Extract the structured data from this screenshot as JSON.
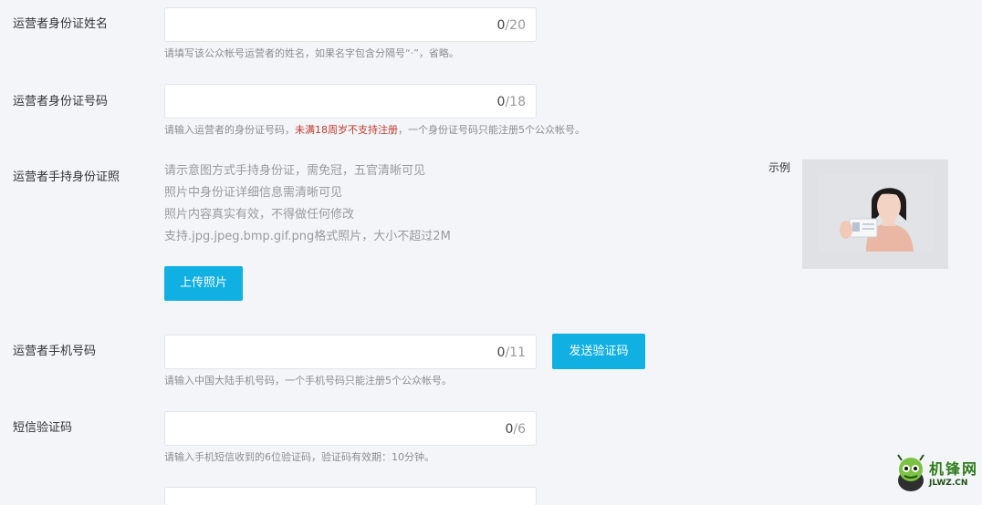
{
  "fields": {
    "name": {
      "label": "运营者身份证姓名",
      "count": "0",
      "max": "/20",
      "hint": "请填写该公众帐号运营者的姓名，如果名字包含分隔号“·”，省略。"
    },
    "id_number": {
      "label": "运营者身份证号码",
      "count": "0",
      "max": "/18",
      "hint_before": "请输入运营者的身份证号码，",
      "hint_warning": "未满18周岁不支持注册",
      "hint_after": "，一个身份证号码只能注册5个公众帐号。"
    },
    "photo": {
      "label": "运营者手持身份证照",
      "desc": [
        "请示意图方式手持身份证，需免冠，五官清晰可见",
        "照片中身份证详细信息需清晰可见",
        "照片内容真实有效，不得做任何修改",
        "支持.jpg.jpeg.bmp.gif.png格式照片，大小不超过2M"
      ],
      "upload_label": "上传照片",
      "sample_label": "示例"
    },
    "phone": {
      "label": "运营者手机号码",
      "count": "0",
      "max": "/11",
      "send_code_label": "发送验证码",
      "hint": "请输入中国大陆手机号码，一个手机号码只能注册5个公众帐号。"
    },
    "sms": {
      "label": "短信验证码",
      "count": "0",
      "max": "/6",
      "hint": "请输入手机短信收到的6位验证码，验证码有效期：10分钟。"
    }
  },
  "watermark": {
    "title": "机锋网",
    "site": "JLWZ.CN"
  },
  "colors": {
    "accent": "#10b0e3",
    "warning": "#c0392b",
    "background": "#f3f5f9"
  }
}
